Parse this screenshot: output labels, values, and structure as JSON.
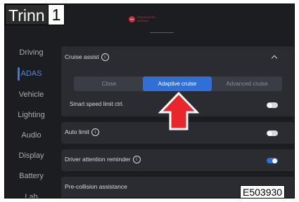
{
  "step": {
    "name": "Trinn",
    "number": "1"
  },
  "status_bar": {
    "airbag_line1": "PASSENGER",
    "airbag_line2": "AIRBAG",
    "airbag_icon": "passenger-airbag-off-icon"
  },
  "sidebar": {
    "items": [
      {
        "label": "Driving",
        "active": false
      },
      {
        "label": "ADAS",
        "active": true
      },
      {
        "label": "Vehicle",
        "active": false
      },
      {
        "label": "Lighting",
        "active": false
      },
      {
        "label": "Audio",
        "active": false
      },
      {
        "label": "Display",
        "active": false
      },
      {
        "label": "Battery",
        "active": false
      },
      {
        "label": "Lab",
        "active": false
      }
    ]
  },
  "cruise_assist": {
    "title": "Cruise assist",
    "info_symbol": "i",
    "modes": [
      "Close",
      "Adaptive cruise",
      "Advanced cruise"
    ],
    "selected_mode": "Adaptive cruise",
    "smart_speed_limit": {
      "label": "Smart speed limit ctrl.",
      "enabled": false
    }
  },
  "auto_limit": {
    "label": "Auto limit",
    "info_symbol": "i",
    "enabled": false
  },
  "driver_attention": {
    "label": "Driver attention reminder",
    "info_symbol": "i",
    "enabled": true
  },
  "pre_collision": {
    "label": "Pre-collision assistance"
  },
  "figure_code": "E503930",
  "colors": {
    "accent": "#2f6fd6",
    "arrow": "#e8262b",
    "background": "#1b1d21",
    "card": "#2a2c31"
  }
}
